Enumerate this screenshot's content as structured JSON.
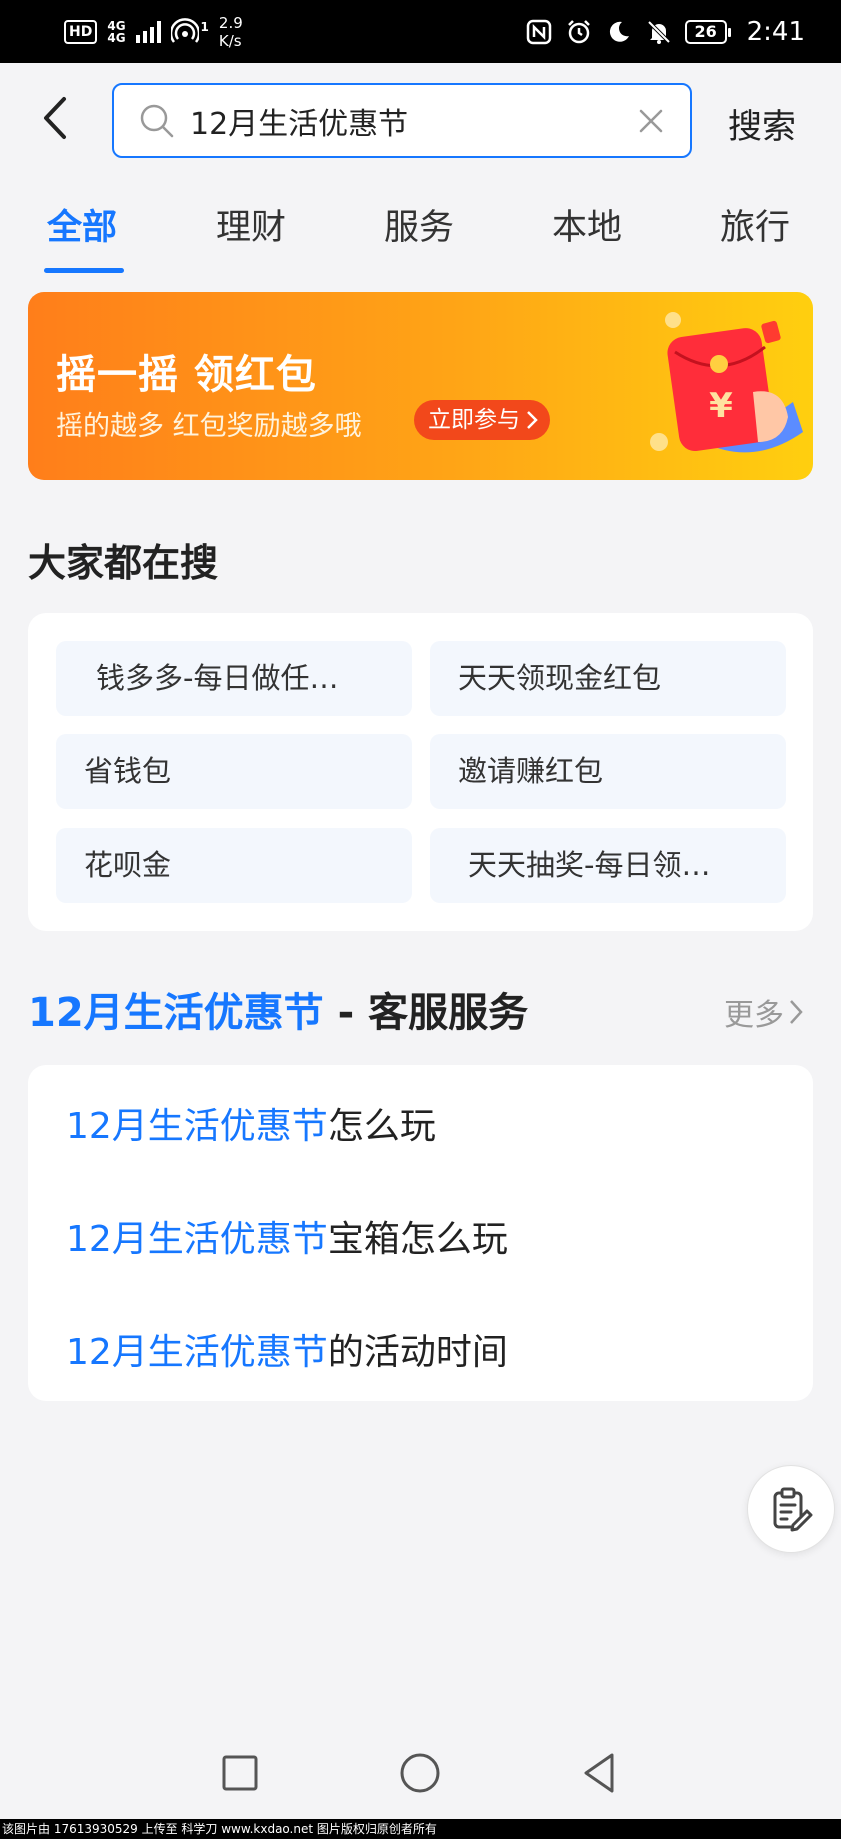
{
  "status_bar": {
    "hd": "HD",
    "network_top": "4G",
    "network_bottom": "4G",
    "hotspot_count": "1",
    "speed_value": "2.9",
    "speed_unit": "K/s",
    "battery": "26",
    "time": "2:41"
  },
  "header": {
    "search_value": "12月生活优惠节",
    "search_button": "搜索"
  },
  "tabs": [
    {
      "label": "全部",
      "active": true
    },
    {
      "label": "理财",
      "active": false
    },
    {
      "label": "服务",
      "active": false
    },
    {
      "label": "本地",
      "active": false
    },
    {
      "label": "旅行",
      "active": false
    }
  ],
  "banner": {
    "title": "摇一摇 领红包",
    "subtitle": "摇的越多 红包奖励越多哦",
    "cta": "立即参与"
  },
  "hot_search": {
    "title": "大家都在搜",
    "items": [
      "钱多多-每日做任…",
      "天天领现金红包",
      "省钱包",
      "邀请赚红包",
      "花呗金",
      "天天抽奖-每日领…"
    ]
  },
  "service": {
    "title_keyword": "12月生活优惠节",
    "title_rest": " - 客服服务",
    "more": "更多",
    "items": [
      {
        "keyword": "12月生活优惠节",
        "suffix": "怎么玩"
      },
      {
        "keyword": "12月生活优惠节",
        "suffix": "宝箱怎么玩"
      },
      {
        "keyword": "12月生活优惠节",
        "suffix": "的活动时间"
      }
    ]
  },
  "watermark": "该图片由 17613930529 上传至 科学刀 www.kxdao.net 图片版权归原创者所有",
  "colors": {
    "accent": "#1677ff",
    "banner_start": "#ff7e1a",
    "banner_end": "#ffcf0f",
    "cta": "#f2481b"
  }
}
